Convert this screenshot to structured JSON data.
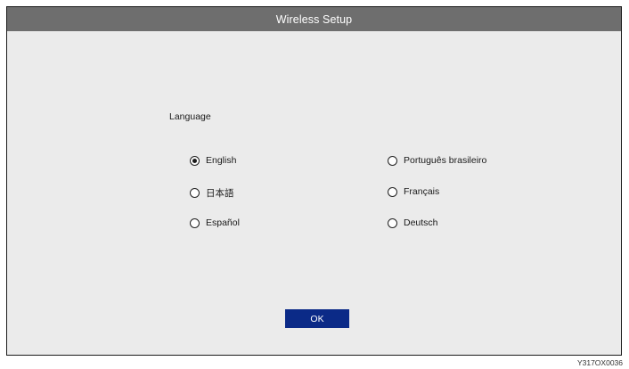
{
  "window": {
    "title": "Wireless Setup"
  },
  "language_section": {
    "label": "Language",
    "selected": "English",
    "options": [
      {
        "label": "English",
        "selected": true
      },
      {
        "label": "日本語",
        "selected": false
      },
      {
        "label": "Español",
        "selected": false
      },
      {
        "label": "Português brasileiro",
        "selected": false
      },
      {
        "label": "Français",
        "selected": false
      },
      {
        "label": "Deutsch",
        "selected": false
      }
    ]
  },
  "actions": {
    "ok_label": "OK"
  },
  "figure_caption": "Y317OX0036",
  "colors": {
    "title_bar": "#6e6e6e",
    "background": "#ebebeb",
    "ok_button": "#0b2a87"
  }
}
